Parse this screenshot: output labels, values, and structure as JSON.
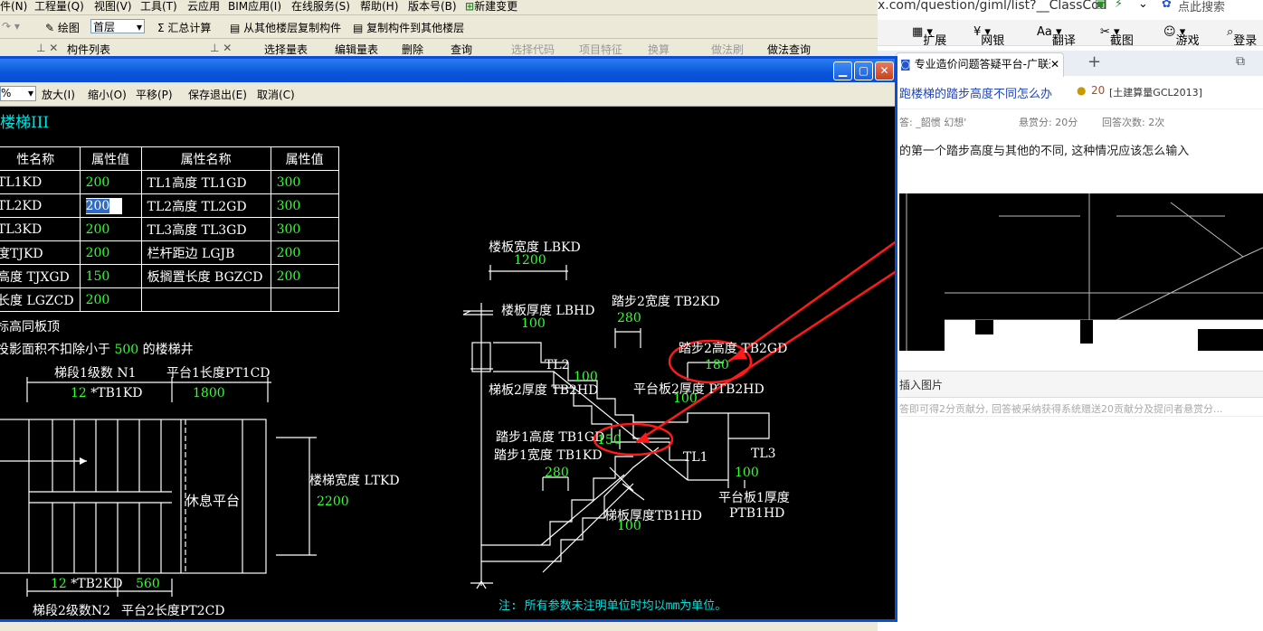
{
  "app": {
    "menu": [
      "件(N)",
      "工程量(Q)",
      "视图(V)",
      "工具(T)",
      "云应用",
      "BIM应用(I)",
      "在线服务(S)",
      "帮助(H)",
      "版本号(B)",
      "新建变更"
    ],
    "toolbar": {
      "draw": "绘图",
      "floor": "首层",
      "sum": "Σ 汇总计算",
      "copy_from": "从其他楼层复制构件",
      "copy_to": "复制构件到其他楼层"
    },
    "panels": {
      "component_list": "构件列表"
    },
    "toolbar2": [
      "选择量表",
      "编辑量表",
      "删除",
      "查询",
      "选择代码",
      "项目特征",
      "换算",
      "做法刷",
      "做法查询"
    ]
  },
  "dialog": {
    "toolbar": {
      "zoom_in": "放大(I)",
      "zoom_out": "缩小(O)",
      "pan": "平移(P)",
      "save_exit": "保存退出(E)",
      "cancel": "取消(C)"
    },
    "heading": "楼梯III",
    "table": {
      "headers": [
        "性名称",
        "属性值",
        "属性名称",
        "属性值"
      ],
      "rows": [
        [
          "TL1KD",
          "200",
          "TL1高度 TL1GD",
          "300"
        ],
        [
          "TL2KD",
          "200",
          "TL2高度 TL2GD",
          "300"
        ],
        [
          "TL3KD",
          "200",
          "TL3高度 TL3GD",
          "300"
        ],
        [
          "度TJKD",
          "200",
          "栏杆距边 LGJB",
          "200"
        ],
        [
          "高度 TJXGD",
          "150",
          "板搁置长度 BGZCD",
          "200"
        ],
        [
          "长度 LGZCD",
          "200",
          "",
          ""
        ]
      ]
    },
    "note1": "标高同板顶",
    "note2_pre": "投影面积不扣除小于",
    "note2_val": "500",
    "note2_post": "的楼梯井",
    "plan": {
      "n1_label": "梯段1级数 N1",
      "pt1cd_label": "平台1长度PT1CD",
      "n1_val": "12",
      "tb1kd": "*TB1KD",
      "pt1cd_val": "1800",
      "rest_platform": "休息平台",
      "ltkd_label": "楼梯宽度 LTKD",
      "ltkd_val": "2200",
      "n2_val": "12",
      "tb2kd": "*TB2KD",
      "pt2cd_val": "560",
      "n2_label": "梯段2级数N2",
      "pt2cd_label": "平台2长度PT2CD"
    },
    "section": {
      "lbkd_label": "楼板宽度 LBKD",
      "lbkd_val": "1200",
      "lbhd_label": "楼板厚度 LBHD",
      "lbhd_val": "100",
      "tb2kd_label": "踏步2宽度 TB2KD",
      "tb2kd_val": "280",
      "tb2gd_label": "踏步2高度 TB2GD",
      "tb2gd_val": "180",
      "tl2": "TL2",
      "tb2hd_val": "100",
      "tb2hd_label": "梯板2厚度 TB2HD",
      "ptb2hd_label": "平台板2厚度 PTB2HD",
      "ptb2hd_val": "100",
      "tb1gd_label": "踏步1高度 TB1GD",
      "tb1gd_val": "150",
      "tb1kd_label": "踏步1宽度 TB1KD",
      "tb1kd_val": "280",
      "tl1": "TL1",
      "tl3": "TL3",
      "ptb1_val": "100",
      "ptb1hd_label1": "平台板1厚度",
      "ptb1hd_label2": "PTB1HD",
      "tb1hd_label": "梯板厚度TB1HD",
      "tb1hd_val": "100"
    },
    "footnote": "注: 所有参数未注明单位时均以mm为单位。"
  },
  "browser": {
    "url": "x.com/question/giml/list?__ClassCod",
    "login": "登录",
    "search": "点此搜索",
    "fav": [
      "扩展",
      "网银",
      "翻译",
      "截图",
      "游戏",
      "登录"
    ],
    "tab_title": "专业造价问题答疑平台-广联达",
    "q_title": "跑楼梯的踏步高度不同怎么办",
    "q_points": "20",
    "q_tag": "[土建算量GCL2013]",
    "asker": "答: _韶惯 幻想'",
    "reward": "悬赏分: 20分",
    "answers": "回答次数: 2次",
    "q_body": "的第一个踏步高度与其他的不同, 这种情况应该怎么输入",
    "insert_image": "插入图片",
    "hint": "答即可得2分贡献分, 回答被采纳获得系统赠送20贡献分及提问者悬赏分..."
  },
  "colors": {
    "cad_bg": "#000000",
    "cad_value": "#33ff33",
    "cad_text": "#ffffff",
    "annotation": "#ff0000",
    "titlebar": "#0a4dd7"
  }
}
